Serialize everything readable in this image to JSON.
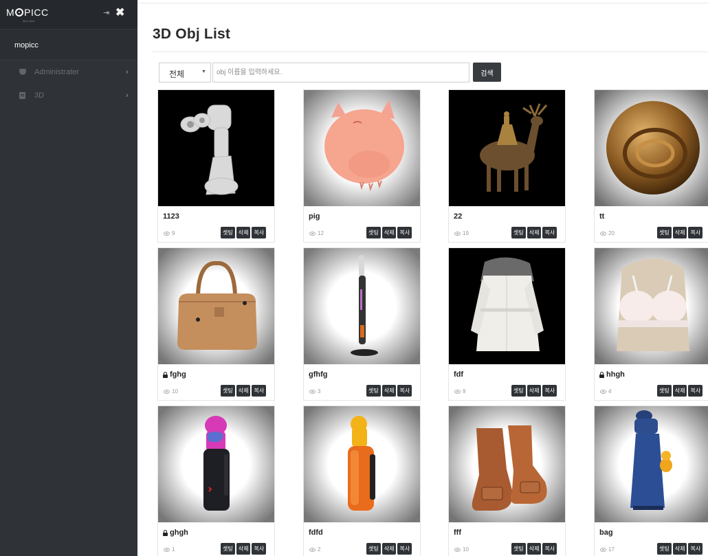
{
  "sidebar": {
    "logo_text": "MOPICC",
    "logo_sub": "3D ▸ view",
    "user_name": "mopicc",
    "items": [
      {
        "label": "Administrater",
        "icon": "shield-icon"
      },
      {
        "label": "3D",
        "icon": "book-icon"
      }
    ]
  },
  "main": {
    "title": "3D Obj List",
    "search": {
      "category_selected": "전체",
      "placeholder": "obj 이름을 입력하세요.",
      "button_label": "검색"
    },
    "card_buttons": {
      "settings": "셋팅",
      "delete": "삭제",
      "copy": "복사"
    },
    "cards": [
      {
        "name": "1123",
        "views": "9",
        "locked": false,
        "image": "stone-figure",
        "bg": "black"
      },
      {
        "name": "pig",
        "views": "12",
        "locked": false,
        "image": "pig-balloon",
        "bg": "vignette"
      },
      {
        "name": "22",
        "views": "19",
        "locked": false,
        "image": "deer-statue",
        "bg": "black"
      },
      {
        "name": "tt",
        "views": "20",
        "locked": false,
        "image": "brass-sphere",
        "bg": "vignette"
      },
      {
        "name": "fghg",
        "views": "10",
        "locked": true,
        "image": "leather-bag",
        "bg": "vignette"
      },
      {
        "name": "gfhfg",
        "views": "3",
        "locked": false,
        "image": "stick-vacuum",
        "bg": "vignette"
      },
      {
        "name": "fdf",
        "views": "9",
        "locked": false,
        "image": "white-coat",
        "bg": "black"
      },
      {
        "name": "hhgh",
        "views": "4",
        "locked": true,
        "image": "bra-mannequin",
        "bg": "vignette"
      },
      {
        "name": "ghgh",
        "views": "1",
        "locked": true,
        "image": "golf-bag-pink",
        "bg": "vignette"
      },
      {
        "name": "fdfd",
        "views": "2",
        "locked": false,
        "image": "golf-bag-orange",
        "bg": "vignette"
      },
      {
        "name": "fff",
        "views": "10",
        "locked": false,
        "image": "brown-boots",
        "bg": "vignette"
      },
      {
        "name": "bag",
        "views": "17",
        "locked": false,
        "image": "golf-bag-blue",
        "bg": "vignette"
      }
    ]
  },
  "colors": {
    "sidebar_bg": "#2f3237",
    "sidebar_header_bg": "#25282c",
    "button_dark": "#2f3337",
    "accent_text": "#222222"
  }
}
